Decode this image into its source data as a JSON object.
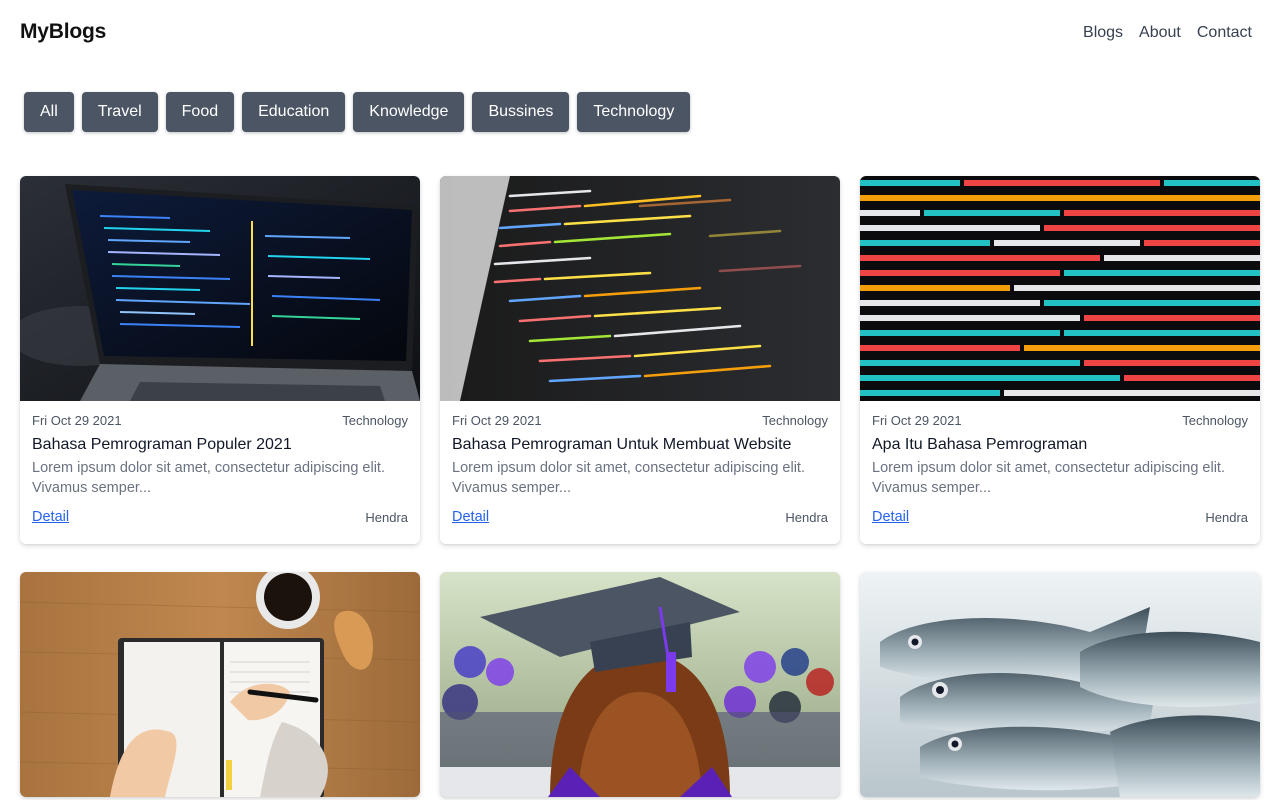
{
  "navbar": {
    "brand": "MyBlogs",
    "links": [
      "Blogs",
      "About",
      "Contact"
    ]
  },
  "filters": [
    "All",
    "Travel",
    "Food",
    "Education",
    "Knowledge",
    "Bussines",
    "Technology"
  ],
  "posts": [
    {
      "date": "Fri Oct 29 2021",
      "category": "Technology",
      "title": "Bahasa Pemrograman Populer 2021",
      "excerpt": "Lorem ipsum dolor sit amet, consectetur adipiscing elit. Vivamus semper...",
      "link": "Detail",
      "author": "Hendra",
      "image": "laptop-code-image"
    },
    {
      "date": "Fri Oct 29 2021",
      "category": "Technology",
      "title": "Bahasa Pemrograman Untuk Membuat Website",
      "excerpt": "Lorem ipsum dolor sit amet, consectetur adipiscing elit. Vivamus semper...",
      "link": "Detail",
      "author": "Hendra",
      "image": "code-screen-image"
    },
    {
      "date": "Fri Oct 29 2021",
      "category": "Technology",
      "title": "Apa Itu Bahasa Pemrograman",
      "excerpt": "Lorem ipsum dolor sit amet, consectetur adipiscing elit. Vivamus semper...",
      "link": "Detail",
      "author": "Hendra",
      "image": "javascript-code-image"
    },
    {
      "image": "notebook-writing-image"
    },
    {
      "image": "graduation-cap-image"
    },
    {
      "image": "fish-image"
    }
  ],
  "colors": {
    "filter_bg": "#4b5563",
    "link": "#2563eb"
  }
}
